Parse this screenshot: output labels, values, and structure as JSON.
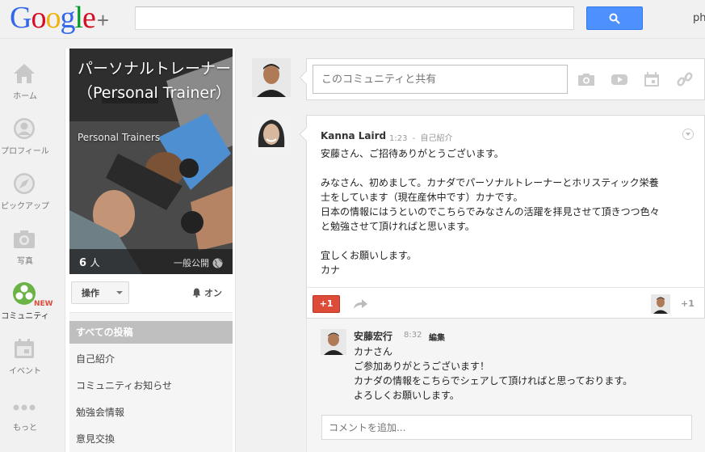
{
  "header": {
    "logo_text": "Google",
    "logo_plus": "+",
    "logo_colors": [
      "#3369e8",
      "#d50f25",
      "#eeb211",
      "#3369e8",
      "#009925",
      "#d50f25"
    ],
    "search_placeholder": "",
    "search_icon": "search-icon",
    "user_name_partial": "phi"
  },
  "left_nav": {
    "items": [
      {
        "label": "ホーム",
        "icon": "home-icon"
      },
      {
        "label": "プロフィール",
        "icon": "profile-icon"
      },
      {
        "label": "ピックアップ",
        "icon": "compass-icon"
      },
      {
        "label": "写真",
        "icon": "camera-icon"
      },
      {
        "label": "コミュニティ",
        "icon": "communities-icon",
        "badge": "NEW"
      },
      {
        "label": "イベント",
        "icon": "calendar-icon"
      },
      {
        "label": "もっと",
        "icon": "more-dots-icon"
      }
    ],
    "active_index": 4
  },
  "community": {
    "title": "パーソナルトレーナー（Personal Trainer）",
    "subtitle": "Personal Trainers",
    "member_count": "6",
    "member_unit": "人",
    "visibility": "一般公開",
    "action_label": "操作",
    "notify_label": "オン",
    "categories": [
      {
        "label": "すべての投稿"
      },
      {
        "label": "自己紹介"
      },
      {
        "label": "コミュニティお知らせ"
      },
      {
        "label": "勉強会情報"
      },
      {
        "label": "意見交換"
      }
    ],
    "active_category": 0
  },
  "share_box": {
    "placeholder": "このコミュニティと共有",
    "icons": [
      "photo-icon",
      "video-icon",
      "event-icon",
      "link-icon"
    ]
  },
  "post": {
    "author": "Kanna Laird",
    "time": "1:23",
    "separator": "-",
    "category": "自己紹介",
    "body": [
      "安藤さん、ご招待ありがとうございます。",
      "",
      "みなさん、初めまして。カナダでパーソナルトレーナーとホリスティック栄養",
      "士をしています（現在産休中です）カナです。",
      "日本の情報にはうといのでこちらでみなさんの活躍を拝見させて頂きつつ色々",
      "と勉強させて頂ければと思います。",
      "",
      "宜しくお願いします。",
      "カナ"
    ],
    "plusone_label": "+1",
    "plus_count": "+1"
  },
  "comment": {
    "author": "安藤宏行",
    "time": "8:32",
    "edit_label": "編集",
    "body": [
      "カナさん",
      "ご参加ありがとうございます！",
      "カナダの情報をこちらでシェアして頂ければと思っております。",
      "よろしくお願いします。"
    ],
    "input_placeholder": "コメントを追加..."
  },
  "colors": {
    "search_blue": "#4d90fe",
    "plusone_red": "#dd4b39",
    "community_green": "#6ab344",
    "new_badge_red": "#dd4b39"
  }
}
